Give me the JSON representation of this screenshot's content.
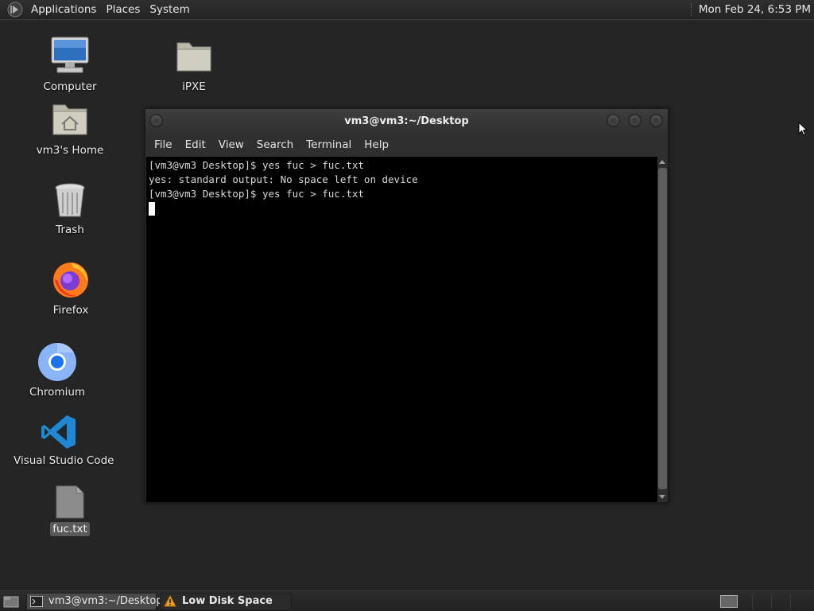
{
  "top_panel": {
    "menus": [
      "Applications",
      "Places",
      "System"
    ],
    "clock": "Mon Feb 24,  6:53 PM"
  },
  "desktop": {
    "icons": [
      {
        "label": "Computer",
        "icon": "computer-icon"
      },
      {
        "label": "iPXE",
        "icon": "folder-icon"
      },
      {
        "label": "vm3's Home",
        "icon": "home-folder-icon"
      },
      {
        "label": "Trash",
        "icon": "trash-icon"
      },
      {
        "label": "Firefox",
        "icon": "firefox-icon"
      },
      {
        "label": "Chromium",
        "icon": "chromium-icon"
      },
      {
        "label": "Visual Studio Code",
        "icon": "vscode-icon"
      },
      {
        "label": "fuc.txt",
        "icon": "text-file-icon"
      }
    ]
  },
  "terminal": {
    "title": "vm3@vm3:~/Desktop",
    "menu": [
      "File",
      "Edit",
      "View",
      "Search",
      "Terminal",
      "Help"
    ],
    "lines": [
      "[vm3@vm3 Desktop]$ yes fuc > fuc.txt",
      "yes: standard output: No space left on device",
      "[vm3@vm3 Desktop]$ yes fuc > fuc.txt"
    ]
  },
  "taskbar": {
    "tasks": [
      {
        "label": "vm3@vm3:~/Desktop",
        "icon": "terminal-icon"
      },
      {
        "label": "Low Disk Space",
        "icon": "warning-icon"
      }
    ]
  }
}
